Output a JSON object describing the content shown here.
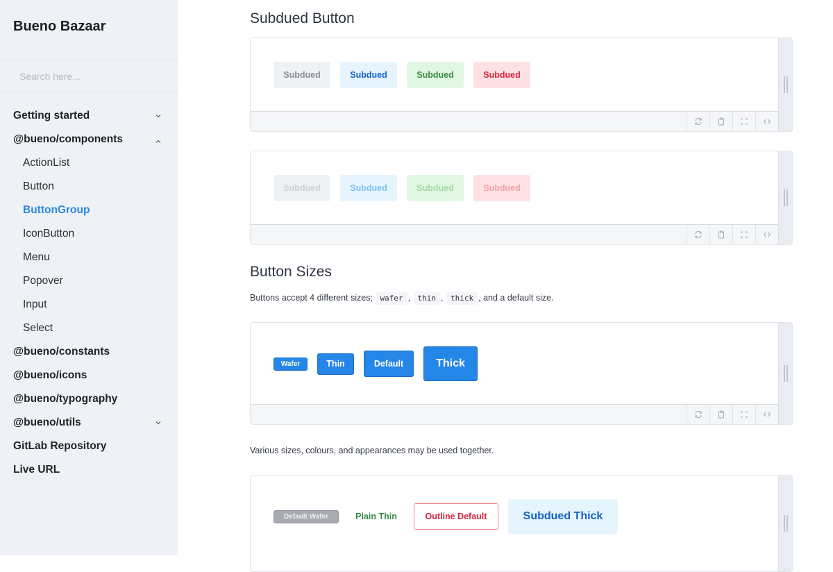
{
  "sidebar": {
    "brand": "Bueno Bazaar",
    "search_placeholder": "Search here...",
    "items": [
      {
        "label": "Getting started",
        "level": "top",
        "chevron": "down"
      },
      {
        "label": "@bueno/components",
        "level": "top",
        "chevron": "up"
      },
      {
        "label": "ActionList",
        "level": "sub"
      },
      {
        "label": "Button",
        "level": "sub"
      },
      {
        "label": "ButtonGroup",
        "level": "sub",
        "active": true
      },
      {
        "label": "IconButton",
        "level": "sub"
      },
      {
        "label": "Menu",
        "level": "sub"
      },
      {
        "label": "Popover",
        "level": "sub"
      },
      {
        "label": "Input",
        "level": "sub"
      },
      {
        "label": "Select",
        "level": "sub"
      },
      {
        "label": "@bueno/constants",
        "level": "top"
      },
      {
        "label": "@bueno/icons",
        "level": "top"
      },
      {
        "label": "@bueno/typography",
        "level": "top"
      },
      {
        "label": "@bueno/utils",
        "level": "top",
        "chevron": "down"
      },
      {
        "label": "GitLab Repository",
        "level": "top"
      },
      {
        "label": "Live URL",
        "level": "top"
      }
    ]
  },
  "main": {
    "subdued_section": {
      "title": "Subdued Button",
      "demo1_buttons": [
        "Subdued",
        "Subdued",
        "Subdued",
        "Subdued"
      ],
      "demo2_buttons": [
        "Subdued",
        "Subdued",
        "Subdued",
        "Subdued"
      ]
    },
    "sizes_section": {
      "title": "Button Sizes",
      "desc_prefix": "Buttons accept 4 different sizes;",
      "codes": [
        "wafer",
        "thin",
        "thick"
      ],
      "sep": ",",
      "desc_suffix": ", and a default size.",
      "size_buttons": [
        "Wafer",
        "Thin",
        "Default",
        "Thick"
      ],
      "combo_desc": "Various sizes, colours, and appearances may be used together.",
      "combo_buttons": [
        "Default Wafer",
        "Plain Thin",
        "Outline Default",
        "Subdued Thick"
      ]
    },
    "toolbar_icons": [
      "refresh-icon",
      "clipboard-icon",
      "fullscreen-icon",
      "code-icon"
    ]
  },
  "colors": {
    "accent": "#2486e6",
    "active_nav": "#2a86e0",
    "subdued_blue_text": "#1463c6",
    "subdued_green_text": "#3b8a44",
    "subdued_red_text": "#d6253c"
  }
}
